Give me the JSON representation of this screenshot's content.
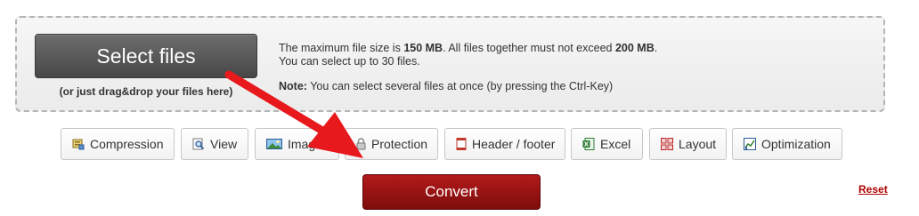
{
  "upload": {
    "select_label": "Select files",
    "drag_hint": "(or just drag&drop your files here)",
    "info_line1_a": "The maximum file size is ",
    "info_line1_b": "150 MB",
    "info_line1_c": ". All files together must not exceed ",
    "info_line1_d": "200 MB",
    "info_line1_e": ".",
    "info_line2": "You can select up to 30 files.",
    "note_label": "Note:",
    "note_text": " You can select several files at once (by pressing the Ctrl-Key)"
  },
  "tabs": [
    {
      "label": "Compression",
      "icon": "compression-icon"
    },
    {
      "label": "View",
      "icon": "magnifier-icon"
    },
    {
      "label": "Image",
      "icon": "image-icon"
    },
    {
      "label": "Protection",
      "icon": "lock-icon"
    },
    {
      "label": "Header / footer",
      "icon": "document-icon"
    },
    {
      "label": "Excel",
      "icon": "excel-icon"
    },
    {
      "label": "Layout",
      "icon": "grid-icon"
    },
    {
      "label": "Optimization",
      "icon": "chart-icon"
    }
  ],
  "actions": {
    "convert_label": "Convert",
    "reset_label": "Reset"
  },
  "colors": {
    "arrow": "#e8191c",
    "convert": "#9e1313",
    "reset_link": "#b00000"
  }
}
